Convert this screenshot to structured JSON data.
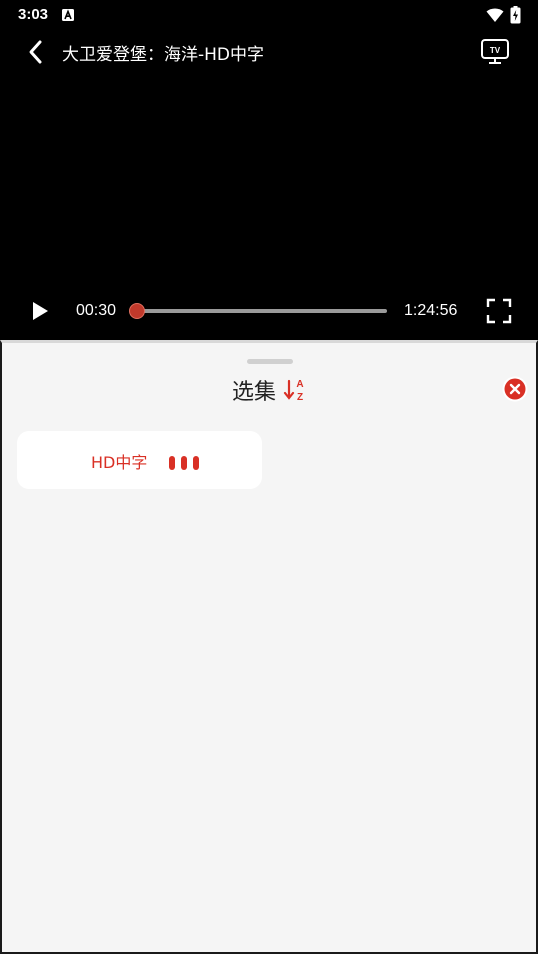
{
  "status_bar": {
    "time": "3:03",
    "icons": [
      "a-notification-icon",
      "wifi-icon",
      "battery-icon"
    ]
  },
  "player": {
    "title": "大卫爱登堡：海洋-HD中字",
    "current_time": "00:30",
    "total_time": "1:24:56",
    "progress_fraction": 0.006,
    "icons": [
      "back-icon",
      "tv-cast-icon",
      "play-icon",
      "fullscreen-icon"
    ]
  },
  "episode_sheet": {
    "title": "选集",
    "sort_letters": [
      "A",
      "Z"
    ],
    "episodes": [
      {
        "label": "HD中字",
        "playing": true
      }
    ]
  },
  "colors": {
    "accent": "#d93025",
    "player_bg": "#000000",
    "sheet_bg": "#f5f5f5",
    "card_bg": "#ffffff"
  }
}
